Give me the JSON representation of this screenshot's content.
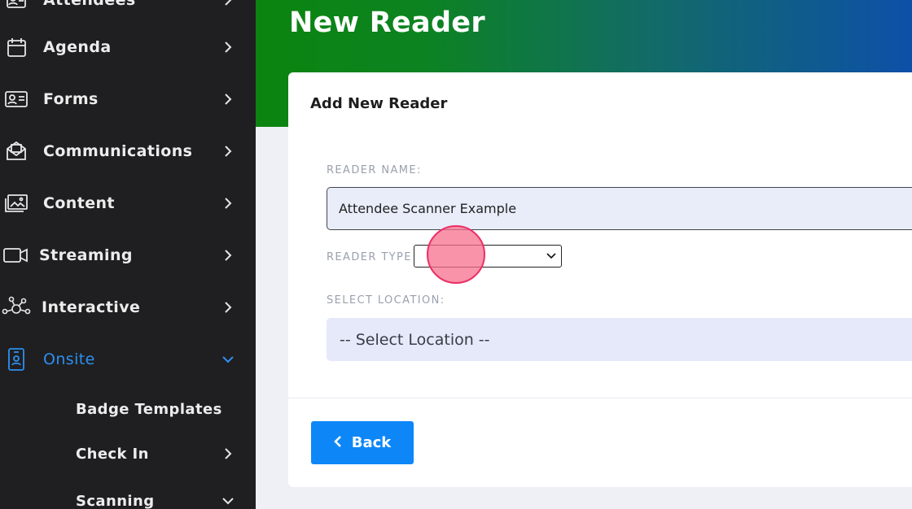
{
  "sidebar": {
    "items": [
      {
        "label": "Attendees",
        "icon": "user-list-icon"
      },
      {
        "label": "Agenda",
        "icon": "calendar-icon"
      },
      {
        "label": "Forms",
        "icon": "id-card-icon"
      },
      {
        "label": "Communications",
        "icon": "envelope-open-icon"
      },
      {
        "label": "Content",
        "icon": "images-icon"
      },
      {
        "label": "Streaming",
        "icon": "video-camera-icon"
      },
      {
        "label": "Interactive",
        "icon": "network-nodes-icon"
      },
      {
        "label": "Onsite",
        "icon": "badge-icon",
        "active": true
      }
    ],
    "sub_items": [
      {
        "label": "Badge Templates"
      },
      {
        "label": "Check In"
      },
      {
        "label": "Scanning"
      }
    ]
  },
  "page": {
    "title": "New Reader"
  },
  "card": {
    "title": "Add New Reader",
    "reader_name_label": "READER NAME:",
    "reader_name_value": "Attendee Scanner Example",
    "reader_type_label": "READER TYPE",
    "reader_type_value": "",
    "location_label": "SELECT LOCATION:",
    "location_value": "-- Select Location --",
    "back_label": "Back"
  },
  "colors": {
    "accent": "#0d87f7",
    "active_nav": "#2d8ff0",
    "sidebar_bg": "#1f1f21",
    "header_green": "#0c840f",
    "header_blue": "#0d50a8"
  }
}
